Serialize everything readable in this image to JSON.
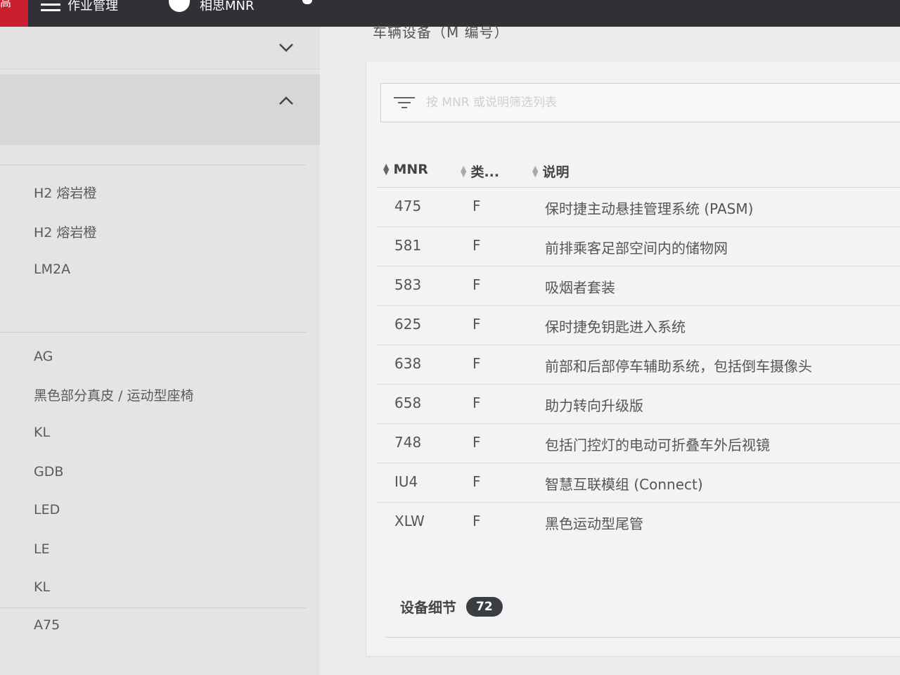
{
  "topbar": {
    "red_tab_text": "高",
    "menu_label": "作业管理",
    "second_label": "相思MNR",
    "colors": {
      "bar": "#2f3136",
      "accent": "#c8202f"
    }
  },
  "left": {
    "items": [
      {
        "label": "H2 熔岩橙"
      },
      {
        "label": "H2 熔岩橙"
      },
      {
        "label": "LM2A"
      },
      {
        "label": "AG"
      },
      {
        "label": "黑色部分真皮 / 运动型座椅"
      },
      {
        "label": "KL"
      },
      {
        "label": "GDB"
      },
      {
        "label": "LED"
      },
      {
        "label": "LE"
      },
      {
        "label": "KL"
      },
      {
        "label": "A75"
      }
    ]
  },
  "panel": {
    "title": "车辆设备（M 编号）",
    "filter_placeholder": "按 MNR 或说明筛选列表",
    "columns": {
      "mnr": "MNR",
      "type": "类...",
      "desc": "说明"
    },
    "rows": [
      {
        "mnr": "475",
        "type": "F",
        "desc": "保时捷主动悬挂管理系统 (PASM)"
      },
      {
        "mnr": "581",
        "type": "F",
        "desc": "前排乘客足部空间内的储物网"
      },
      {
        "mnr": "583",
        "type": "F",
        "desc": "吸烟者套装"
      },
      {
        "mnr": "625",
        "type": "F",
        "desc": "保时捷免钥匙进入系统"
      },
      {
        "mnr": "638",
        "type": "F",
        "desc": "前部和后部停车辅助系统，包括倒车摄像头"
      },
      {
        "mnr": "658",
        "type": "F",
        "desc": "助力转向升级版"
      },
      {
        "mnr": "748",
        "type": "F",
        "desc": "包括门控灯的电动可折叠车外后视镜"
      },
      {
        "mnr": "IU4",
        "type": "F",
        "desc": "智慧互联模组 (Connect)"
      },
      {
        "mnr": "XLW",
        "type": "F",
        "desc": "黑色运动型尾管"
      }
    ],
    "details_label": "设备细节",
    "details_count": "72"
  }
}
